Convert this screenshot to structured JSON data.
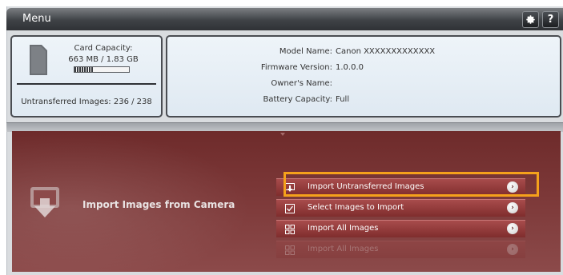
{
  "titlebar": {
    "title": "Menu",
    "settings_icon": "gear-icon",
    "help_label": "?"
  },
  "card": {
    "icon": "memory-card-icon",
    "capacity_label": "Card Capacity:",
    "capacity_value": "663 MB / 1.83 GB",
    "capacity_used_fraction": 0.35,
    "untransferred": "Untransferred Images: 236 / 238"
  },
  "camera_info": {
    "rows": [
      {
        "key": "Model Name:",
        "value": "Canon XXXXXXXXXXXXX"
      },
      {
        "key": "Firmware Version:",
        "value": "1.0.0.0"
      },
      {
        "key": "Owner's Name:",
        "value": ""
      },
      {
        "key": "Battery Capacity:",
        "value": "Full"
      }
    ]
  },
  "import": {
    "title": "Import Images from Camera",
    "icon": "import-download-icon",
    "options": [
      {
        "label": "Import Untransferred Images",
        "icon": "import-arrow-icon"
      },
      {
        "label": "Select Images to Import",
        "icon": "checkbox-icon"
      },
      {
        "label": "Import All Images",
        "icon": "grid-icon"
      },
      {
        "label": "Import All Images",
        "icon": "grid-icon"
      }
    ],
    "highlight_color": "#f5a11b"
  },
  "colors": {
    "accent": "#f5a11b",
    "import_bg": "#7c3838",
    "panel_bg": "#e6eef5"
  }
}
